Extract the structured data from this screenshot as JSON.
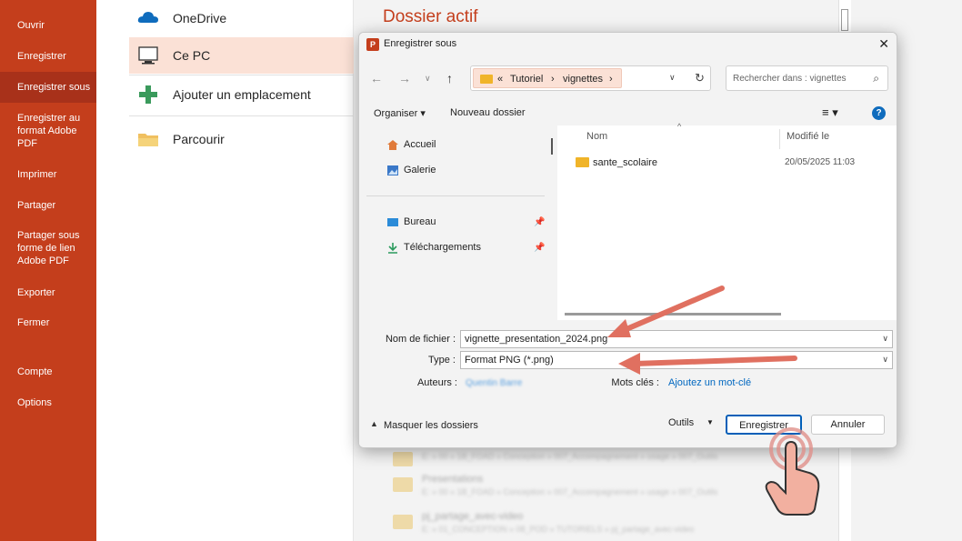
{
  "backstage": {
    "menu": [
      "Ouvrir",
      "Enregistrer",
      "Enregistrer sous",
      "Enregistrer au format Adobe PDF",
      "Imprimer",
      "Partager",
      "Partager sous forme de lien Adobe PDF",
      "Exporter",
      "Fermer",
      "Compte",
      "Options"
    ],
    "selected": "Enregistrer sous",
    "locations": [
      "OneDrive",
      "Ce PC",
      "Ajouter un emplacement",
      "Parcourir"
    ],
    "selected_location": "Ce PC",
    "section_title": "Dossier actif",
    "bg_folders": [
      "Presentations",
      "pj_partage_avec-video"
    ]
  },
  "dialog": {
    "title": "Enregistrer sous",
    "close": "✕",
    "breadcrumb": [
      "«",
      "Tutoriel",
      "›",
      "vignettes",
      "›"
    ],
    "search_placeholder": "Rechercher dans : vignettes",
    "toolbar": {
      "organize": "Organiser ▾",
      "new_folder": "Nouveau dossier"
    },
    "nav": {
      "home": "Accueil",
      "gallery": "Galerie",
      "desktop": "Bureau",
      "downloads": "Téléchargements"
    },
    "columns": {
      "name": "Nom",
      "modified": "Modifié le"
    },
    "files": [
      {
        "name": "sante_scolaire",
        "modified": "20/05/2025 11:03"
      }
    ],
    "filename_label": "Nom de fichier :",
    "filename_value": "vignette_presentation_2024.png",
    "type_label": "Type :",
    "type_value": "Format PNG (*.png)",
    "authors_label": "Auteurs :",
    "authors_value": "Quentin Barre",
    "keywords_label": "Mots clés :",
    "keywords_link": "Ajoutez un mot-clé",
    "hide_folders": "Masquer les dossiers",
    "tools": "Outils",
    "save": "Enregistrer",
    "cancel": "Annuler"
  },
  "colors": {
    "accent": "#c43e1c",
    "annotation": "#e07060",
    "link": "#0067c0"
  }
}
